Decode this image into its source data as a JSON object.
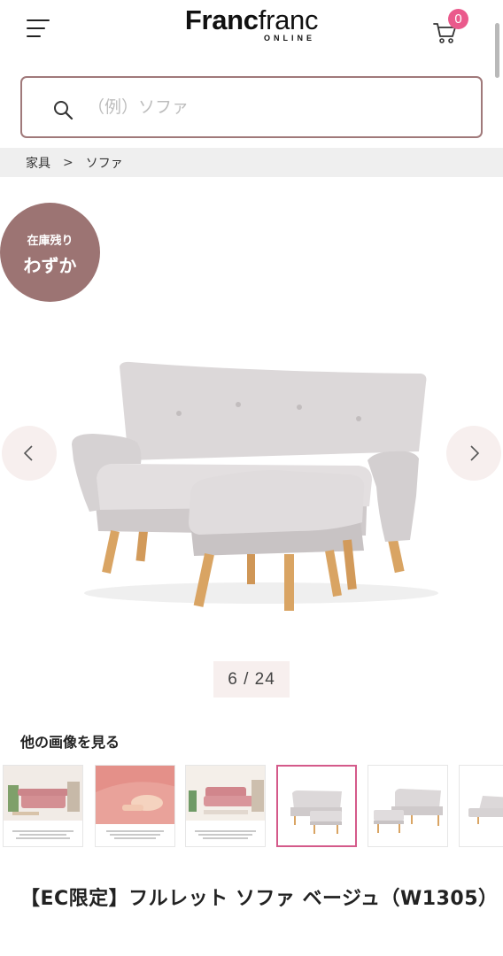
{
  "header": {
    "logo_main_bold": "Franc",
    "logo_main_regular": "franc",
    "logo_sub": "ONLINE",
    "cart_count": "0"
  },
  "search": {
    "placeholder": "（例）ソファ",
    "value": ""
  },
  "breadcrumb": {
    "items": [
      "家具",
      "ソファ"
    ],
    "separator": ">"
  },
  "stock_badge": {
    "line1": "在庫残り",
    "line2": "わずか"
  },
  "gallery": {
    "counter": "6 / 24",
    "more_images_label": "他の画像を見る",
    "active_thumb_index": 3
  },
  "product": {
    "title": "【EC限定】フルレット ソファ ベージュ（W1305）"
  },
  "colors": {
    "accent_pink": "#ea5a8c",
    "brand_mauve": "#9c7473",
    "search_border": "#a0797a",
    "nav_button_bg": "#f7efee",
    "breadcrumb_bg": "#efefef",
    "sofa_fabric": "#d9d5d6",
    "wood_legs": "#d9a463"
  },
  "icons": {
    "menu": "hamburger-icon",
    "cart": "cart-icon",
    "search": "search-icon",
    "prev": "chevron-left-icon",
    "next": "chevron-right-icon"
  }
}
